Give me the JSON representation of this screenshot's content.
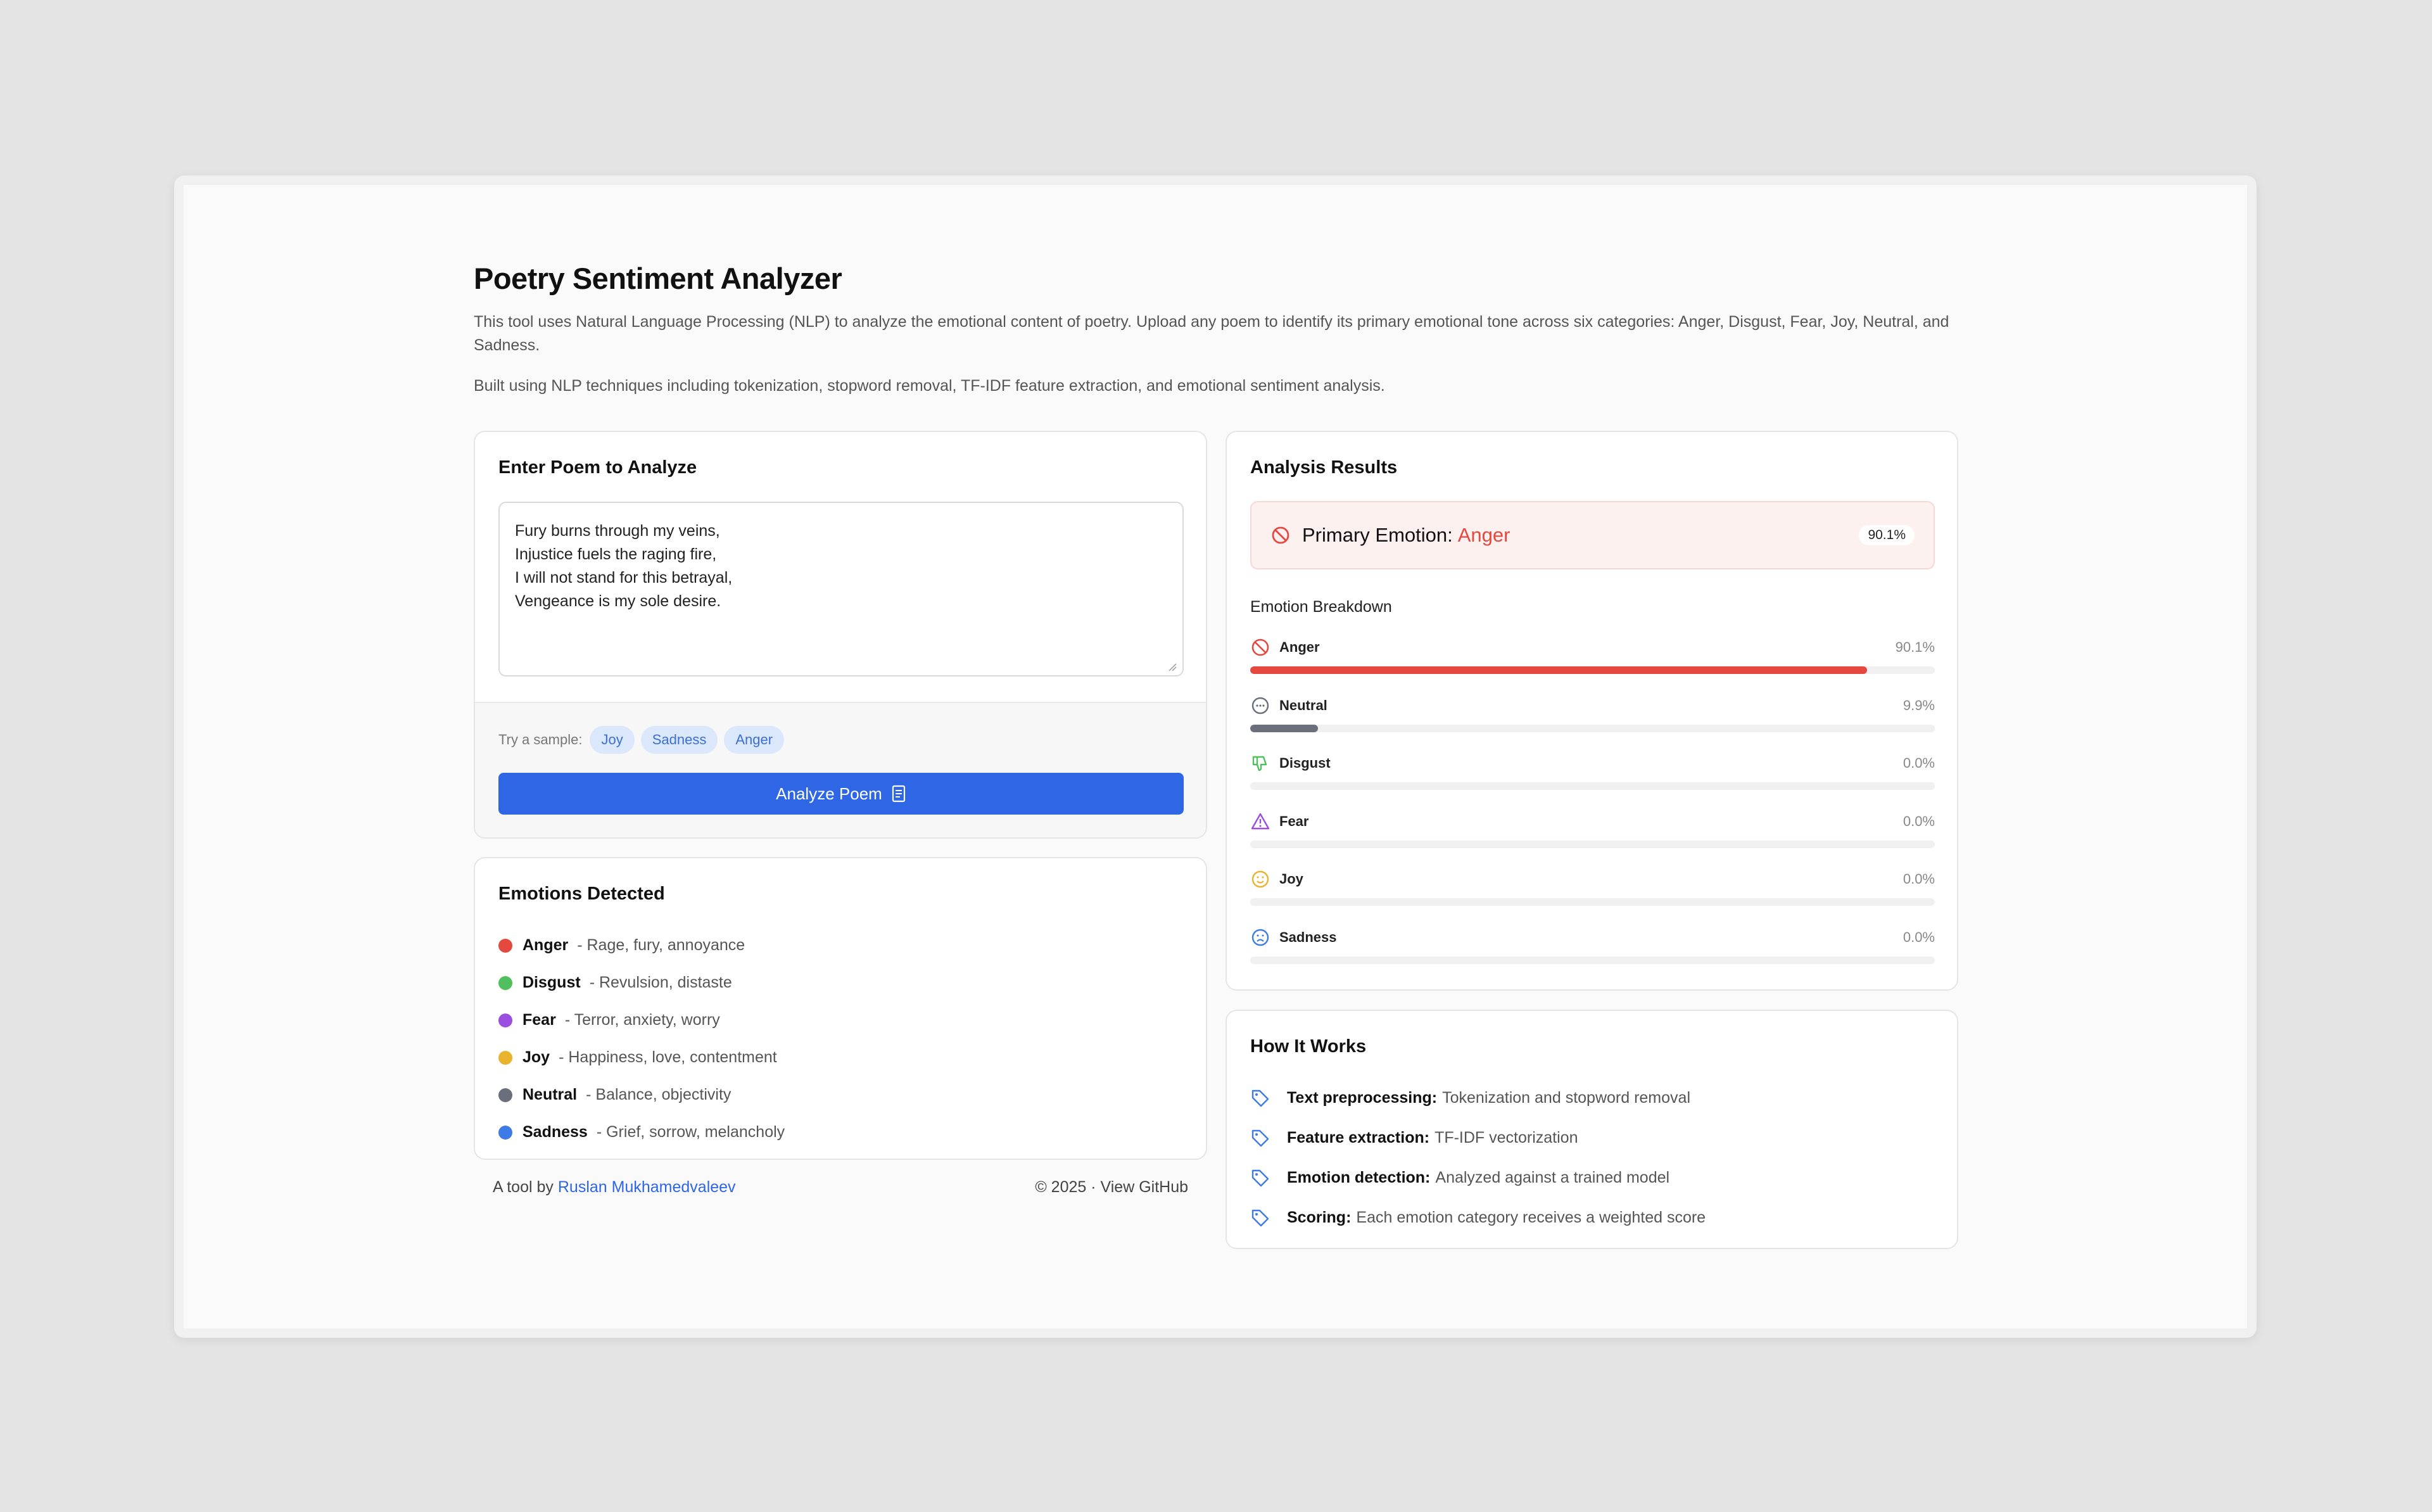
{
  "header": {
    "title": "Poetry Sentiment Analyzer",
    "description": "This tool uses Natural Language Processing (NLP) to analyze the emotional content of poetry. Upload any poem to identify its primary emotional tone across six categories: Anger, Disgust, Fear, Joy, Neutral, and Sadness.",
    "built_with": "Built using NLP techniques including tokenization, stopword removal, TF-IDF feature extraction, and emotional sentiment analysis."
  },
  "input_card": {
    "title": "Enter Poem to Analyze",
    "poem": "Fury burns through my veins,\nInjustice fuels the raging fire,\nI will not stand for this betrayal,\nVengeance is my sole desire.",
    "sample_label": "Try a sample:",
    "samples": [
      "Joy",
      "Sadness",
      "Anger"
    ],
    "analyze_label": "Analyze Poem"
  },
  "emotions_card": {
    "title": "Emotions Detected",
    "items": [
      {
        "name": "Anger",
        "desc": "- Rage, fury, annoyance",
        "color": "#e5483f"
      },
      {
        "name": "Disgust",
        "desc": "- Revulsion, distaste",
        "color": "#4fbf5f"
      },
      {
        "name": "Fear",
        "desc": "- Terror, anxiety, worry",
        "color": "#9b4fe0"
      },
      {
        "name": "Joy",
        "desc": "- Happiness, love, contentment",
        "color": "#e8b32f"
      },
      {
        "name": "Neutral",
        "desc": "- Balance, objectivity",
        "color": "#6b6f7b"
      },
      {
        "name": "Sadness",
        "desc": "- Grief, sorrow, melancholy",
        "color": "#3f7be6"
      }
    ]
  },
  "footer": {
    "prefix": "A tool by",
    "author": "Ruslan Mukhamedvaleev",
    "right": "© 2025 · View GitHub"
  },
  "results_card": {
    "title": "Analysis Results",
    "primary_label": "Primary Emotion:",
    "primary_emotion": "Anger",
    "primary_pct": "90.1%",
    "breakdown_title": "Emotion Breakdown",
    "breakdown": [
      {
        "name": "Anger",
        "pct": "90.1%",
        "value": 90.1,
        "color": "#e5483f",
        "icon": "ban-icon"
      },
      {
        "name": "Neutral",
        "pct": "9.9%",
        "value": 9.9,
        "color": "#6b6f7b",
        "icon": "dots-circle-icon"
      },
      {
        "name": "Disgust",
        "pct": "0.0%",
        "value": 0,
        "color": "#4fbf5f",
        "icon": "thumbs-down-icon"
      },
      {
        "name": "Fear",
        "pct": "0.0%",
        "value": 0,
        "color": "#9b4fe0",
        "icon": "warning-icon"
      },
      {
        "name": "Joy",
        "pct": "0.0%",
        "value": 0,
        "color": "#e8b32f",
        "icon": "smile-icon"
      },
      {
        "name": "Sadness",
        "pct": "0.0%",
        "value": 0,
        "color": "#3f7be6",
        "icon": "frown-icon"
      }
    ]
  },
  "how_card": {
    "title": "How It Works",
    "items": [
      {
        "label": "Text preprocessing:",
        "text": "Tokenization and stopword removal"
      },
      {
        "label": "Feature extraction:",
        "text": "TF-IDF vectorization"
      },
      {
        "label": "Emotion detection:",
        "text": "Analyzed against a trained model"
      },
      {
        "label": "Scoring:",
        "text": "Each emotion category receives a weighted score"
      }
    ]
  }
}
